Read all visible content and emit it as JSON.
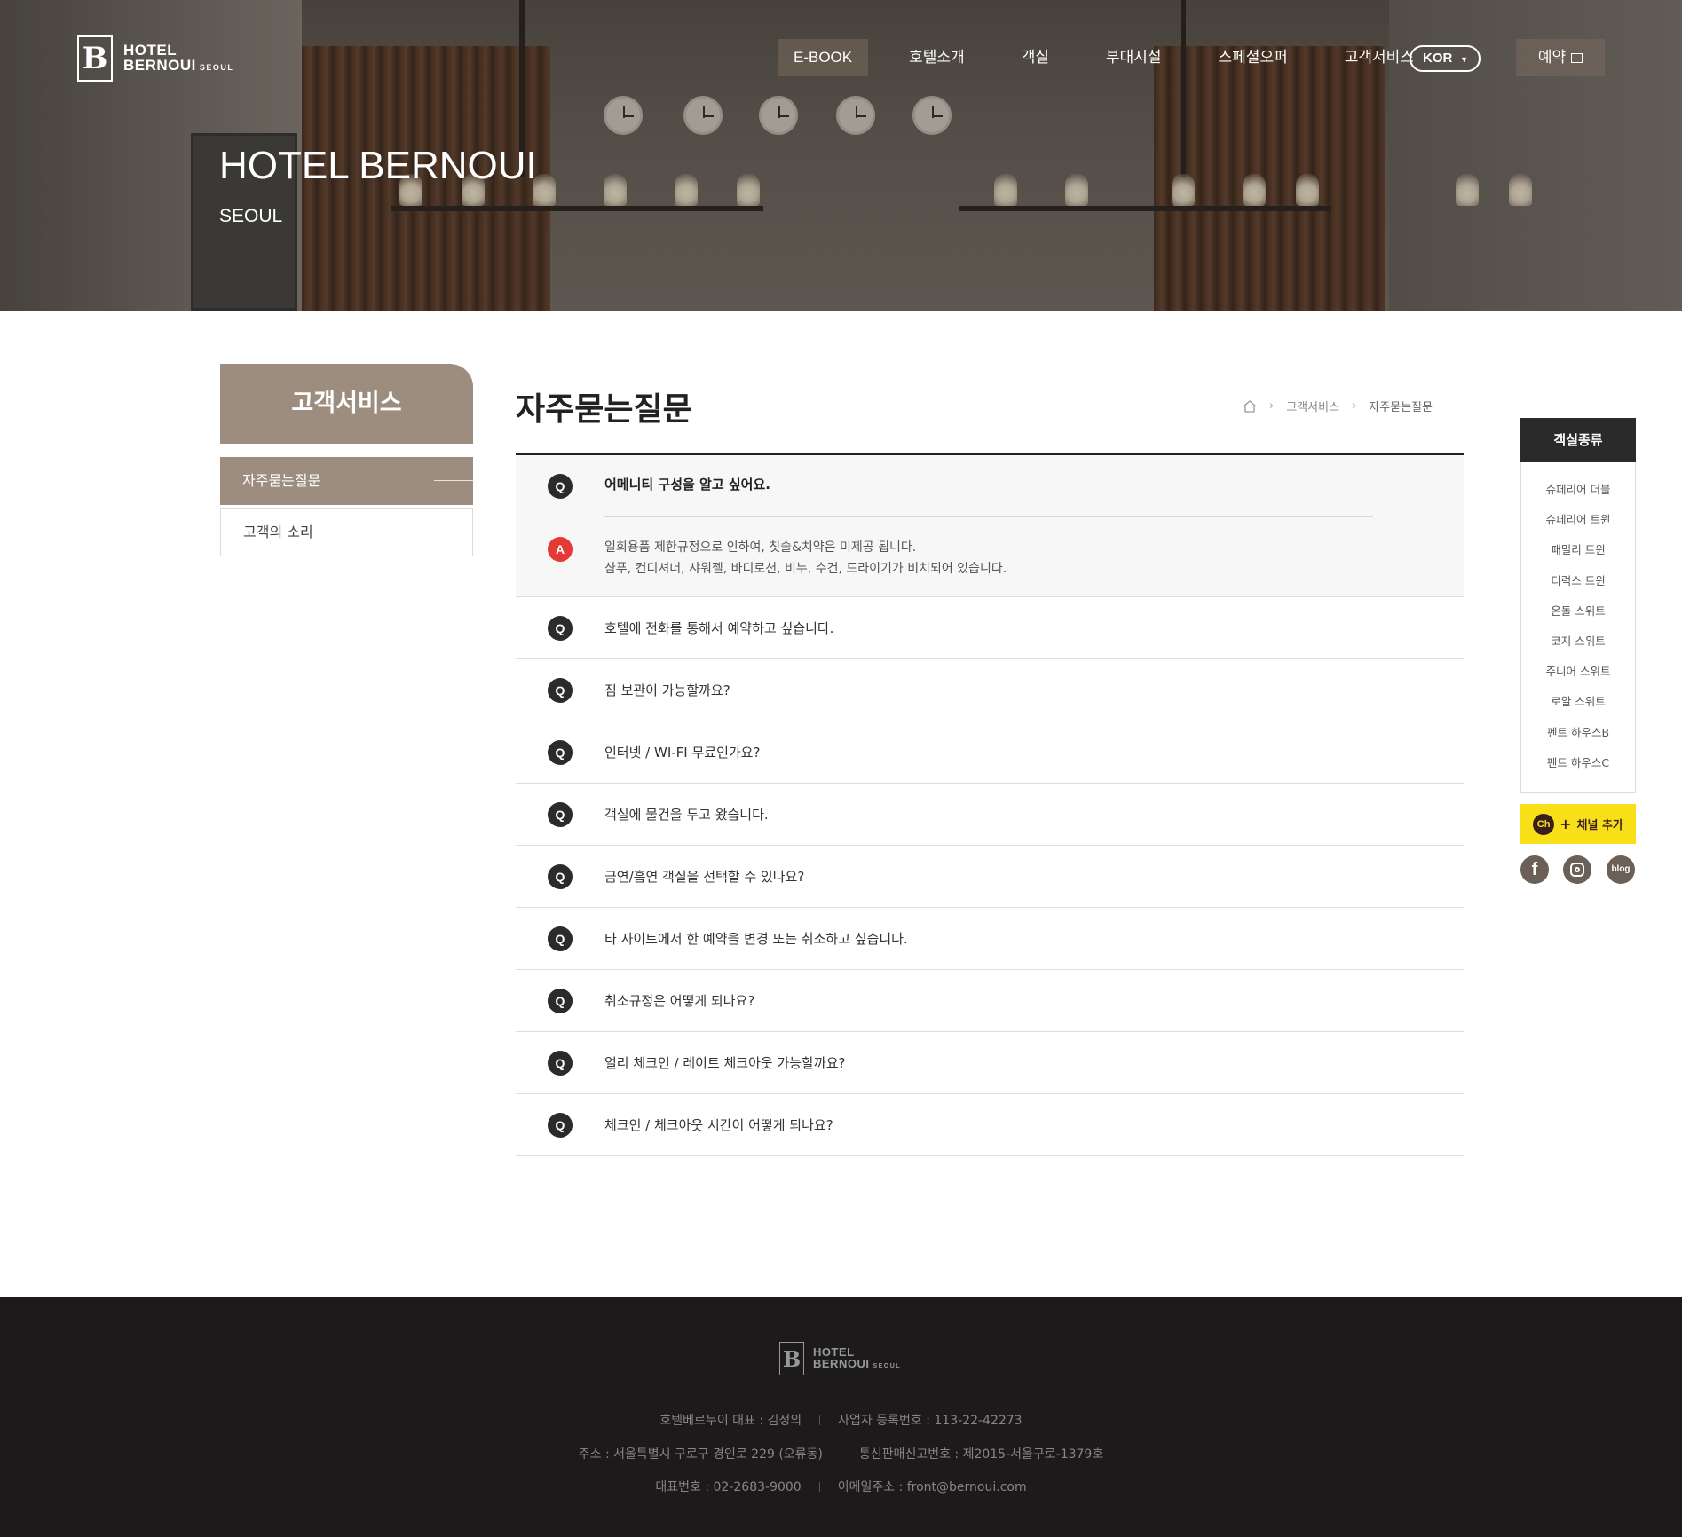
{
  "header": {
    "logo": {
      "line1": "HOTEL",
      "line2": "BERNOUI",
      "line2_small": "SEOUL"
    },
    "nav": [
      {
        "label": "E-BOOK"
      },
      {
        "label": "호텔소개"
      },
      {
        "label": "객실"
      },
      {
        "label": "부대시설"
      },
      {
        "label": "스페셜오퍼"
      },
      {
        "label": "고객서비스"
      }
    ],
    "language": "KOR",
    "reserve_label": "예약"
  },
  "hero": {
    "title": "HOTEL BERNOUI",
    "subtitle": "SEOUL"
  },
  "sidebar": {
    "title": "고객서비스",
    "items": [
      {
        "label": "자주묻는질문",
        "active": true
      },
      {
        "label": "고객의 소리",
        "active": false
      }
    ]
  },
  "main": {
    "title": "자주묻는질문",
    "breadcrumb": [
      "고객서비스",
      "자주묻는질문"
    ],
    "faq": [
      {
        "q": "어메니티 구성을 알고 싶어요.",
        "open": true,
        "answer": [
          "일회용품 제한규정으로 인하여, 칫솔&치약은 미제공 됩니다.",
          "샴푸, 컨디셔너, 샤워젤, 바디로션, 비누, 수건, 드라이기가 비치되어 있습니다."
        ]
      },
      {
        "q": "호텔에 전화를 통해서 예약하고 싶습니다."
      },
      {
        "q": "짐 보관이 가능할까요?"
      },
      {
        "q": "인터넷 / WI-FI 무료인가요?"
      },
      {
        "q": "객실에 물건을 두고 왔습니다."
      },
      {
        "q": "금연/흡연 객실을 선택할 수 있나요?"
      },
      {
        "q": "타 사이트에서 한 예약을 변경 또는 취소하고 싶습니다."
      },
      {
        "q": "취소규정은 어떻게 되나요?"
      },
      {
        "q": "얼리 체크인 / 레이트 체크아웃 가능할까요?"
      },
      {
        "q": "체크인 / 체크아웃 시간이 어떻게 되나요?"
      }
    ],
    "q_badge": "Q",
    "a_badge": "A"
  },
  "quick_menu": {
    "title": "객실종류",
    "items": [
      "슈페리어 더블",
      "슈페리어 트윈",
      "패밀리 트윈",
      "디럭스 트윈",
      "온돌 스위트",
      "코지 스위트",
      "주니어 스위트",
      "로얄 스위트",
      "펜트 하우스B",
      "펜트 하우스C"
    ],
    "kakao_label": "채널 추가",
    "kakao_badge": "Ch",
    "social": {
      "facebook": "f",
      "blog": "blog"
    }
  },
  "footer": {
    "logo": {
      "line1": "HOTEL",
      "line2": "BERNOUI",
      "line2_small": "SEOUL"
    },
    "row1": [
      "호텔베르누이 대표 : 김정의",
      "사업자 등록번호 : 113-22-42273"
    ],
    "row2": [
      "주소 : 서울특별시 구로구 경인로 229 (오류동)",
      "통신판매신고번호 : 제2015-서울구로-1379호"
    ],
    "row3": [
      "대표번호 : 02-2683-9000",
      "이메일주소 : front@bernoui.com"
    ]
  },
  "colors": {
    "accent": "#9c8d7e",
    "answer_badge": "#e53935",
    "question_badge": "#2b2b2b",
    "kakao": "#f8e018",
    "footer": "#1c1a1a"
  }
}
